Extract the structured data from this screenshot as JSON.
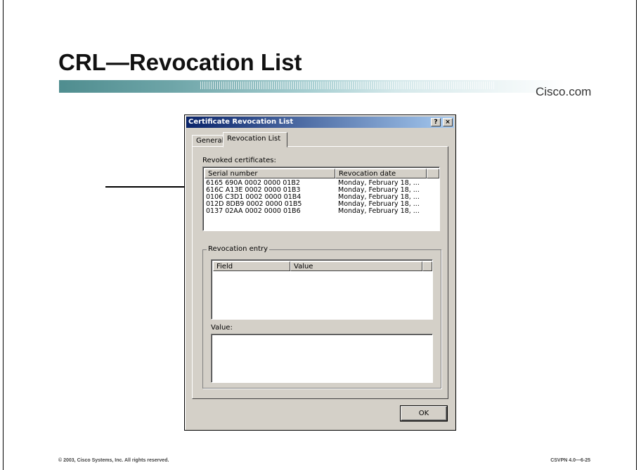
{
  "slide": {
    "title": "CRL—Revocation List",
    "brand": "Cisco.com",
    "footer_left": "© 2003, Cisco Systems, Inc. All rights reserved.",
    "footer_right": "CSVPN 4.0—6-25"
  },
  "dialog": {
    "title": "Certificate Revocation List",
    "help_btn": "?",
    "close_btn": "×",
    "tabs": [
      {
        "label": "General",
        "active": false
      },
      {
        "label": "Revocation List",
        "active": true
      }
    ],
    "revoked_label": "Revoked certificates:",
    "columns": [
      "Serial number",
      "Revocation date"
    ],
    "rows": [
      {
        "serial": "6165 690A 0002 0000 01B2",
        "date": "Monday, February 18, ..."
      },
      {
        "serial": "616C A13E 0002 0000 01B3",
        "date": "Monday, February 18, ..."
      },
      {
        "serial": "0106 C3D1 0002 0000 01B4",
        "date": "Monday, February 18, ..."
      },
      {
        "serial": "012D 8DB9 0002 0000 01B5",
        "date": "Monday, February 18, ..."
      },
      {
        "serial": "0137 02AA 0002 0000 01B6",
        "date": "Monday, February 18, ..."
      }
    ],
    "entry_group": "Revocation entry",
    "entry_columns": [
      "Field",
      "Value"
    ],
    "value_label": "Value:",
    "ok_label": "OK"
  }
}
